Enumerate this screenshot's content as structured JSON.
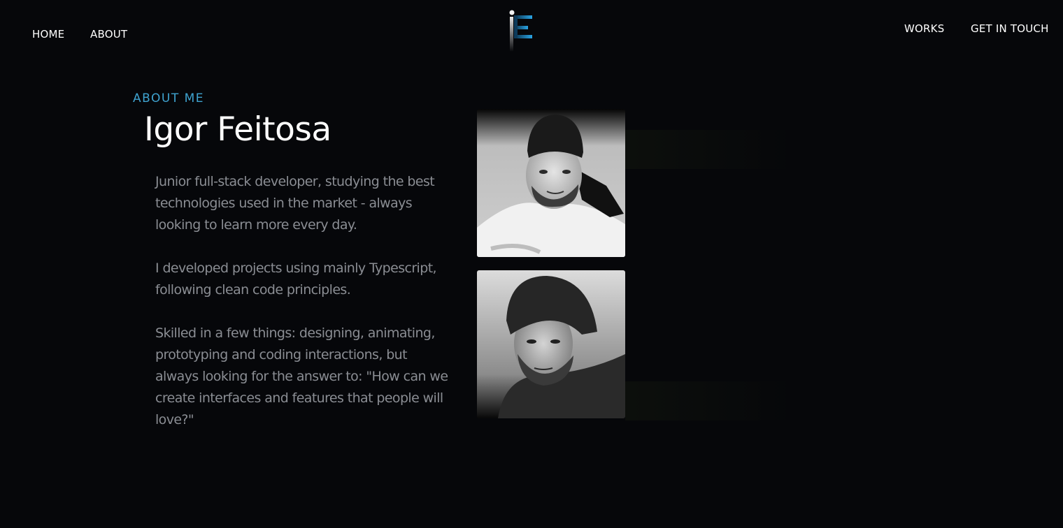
{
  "nav": {
    "home": "HOME",
    "about": "ABOUT",
    "works": "WORKS",
    "contact": "GET IN TOUCH"
  },
  "about": {
    "eyebrow": "ABOUT ME",
    "name": "Igor Feitosa",
    "paragraphs": [
      "Junior full-stack developer, studying the best technologies used in the market - always looking to learn more every day.",
      "I developed projects using mainly Typescript, following clean code principles.",
      "Skilled in a few things: designing, animating, prototyping and coding interactions, but always looking for the answer to: \"How can we create interfaces and features that people will love?\""
    ]
  },
  "colors": {
    "background": "#06070a",
    "accent": "#3fa3d0",
    "body_text": "#8a8d93",
    "heading": "#ffffff"
  },
  "icons": {
    "logo": "if-monogram-logo"
  }
}
